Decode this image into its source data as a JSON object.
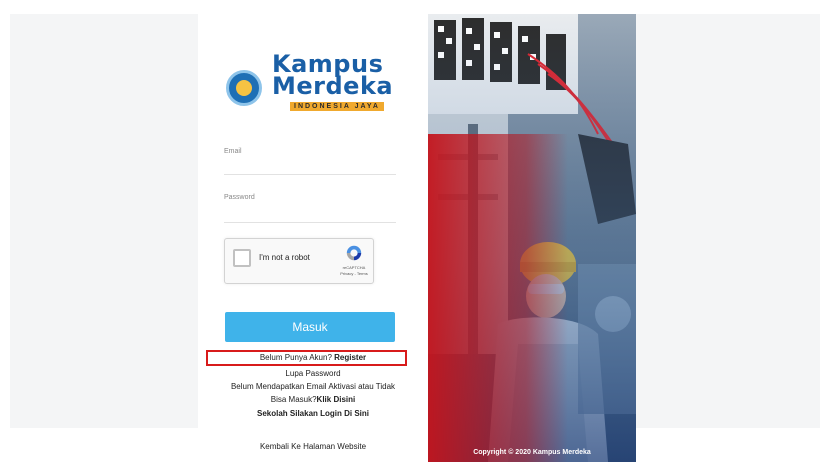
{
  "login": {
    "logo": {
      "line1": "Kampus",
      "line2": "Merdeka",
      "tagline": "INDONESIA JAYA"
    },
    "email_label": "Email",
    "password_label": "Password",
    "recaptcha": {
      "label": "I'm not a robot",
      "brand": "reCAPTCHA",
      "links": "Privacy - Terms"
    },
    "submit_label": "Masuk",
    "register": {
      "prefix": "Belum Punya Akun? ",
      "link": "Register"
    },
    "forgot_password": "Lupa Password",
    "activation_line1": "Belum Mendapatkan Email Aktivasi atau Tidak",
    "activation_line2_prefix": "Bisa Masuk?",
    "activation_line2_link": "Klik Disini",
    "school_login": "Sekolah Silakan Login Di Sini",
    "back_to_website": "Kembali Ke Halaman Website"
  },
  "photo": {
    "copyright": "Copyright © 2020 Kampus Merdeka"
  },
  "colors": {
    "primary_button": "#3fb3ea",
    "highlight": "#d81b1b",
    "logo_blue": "#1a5fa6",
    "logo_orange": "#f0a92e"
  }
}
